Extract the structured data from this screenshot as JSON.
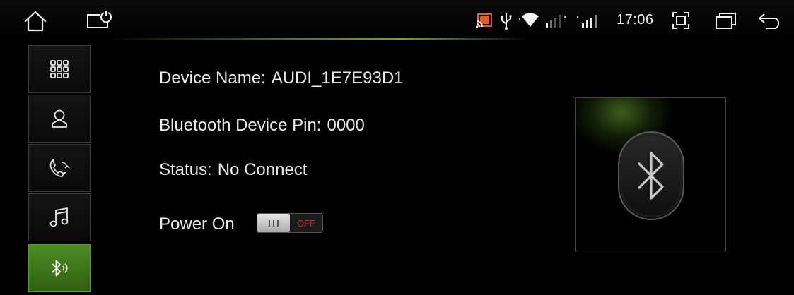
{
  "status_bar": {
    "time": "17:06",
    "icons": [
      "home-icon",
      "screen-off-icon",
      "cast-icon",
      "usb-icon",
      "wifi-icon",
      "signal-icon",
      "signal-icon",
      "fullscreen-icon",
      "recents-icon",
      "back-icon"
    ]
  },
  "sidebar": {
    "items": [
      {
        "icon": "apps-grid-icon",
        "active": false
      },
      {
        "icon": "contacts-icon",
        "active": false
      },
      {
        "icon": "call-log-icon",
        "active": false
      },
      {
        "icon": "music-icon",
        "active": false
      },
      {
        "icon": "bluetooth-settings-icon",
        "active": true
      }
    ]
  },
  "device": {
    "name_label": "Device Name:",
    "name_value": "AUDI_1E7E93D1",
    "pin_label": "Bluetooth Device Pin:",
    "pin_value": "0000",
    "status_label": "Status:",
    "status_value": "No Connect",
    "power_label": "Power On",
    "power_toggle_state": "OFF"
  },
  "colors": {
    "accent_green": "#4d8a22",
    "toggle_off_red": "#e02020",
    "background": "#000000"
  }
}
